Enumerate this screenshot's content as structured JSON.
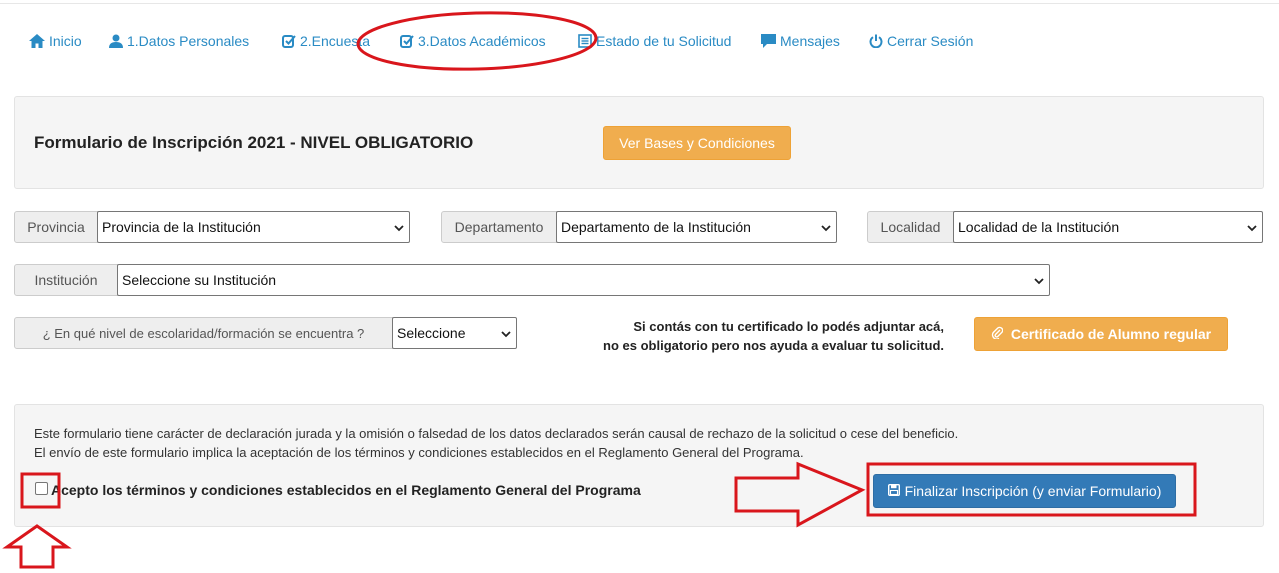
{
  "nav": {
    "inicio": "Inicio",
    "datos_personales": "1.Datos Personales",
    "encuesta": "2.Encuesta",
    "datos_academicos": "3.Datos Académicos",
    "estado_solicitud": "Estado de tu Solicitud",
    "mensajes": "Mensajes",
    "cerrar_sesion": "Cerrar Sesión"
  },
  "header": {
    "title": "Formulario de Inscripción 2021 - NIVEL OBLIGATORIO",
    "bases_button": "Ver Bases y Condiciones"
  },
  "filters": {
    "provincia": {
      "label": "Provincia",
      "value": "Provincia de la Institución"
    },
    "departamento": {
      "label": "Departamento",
      "value": "Departamento de la Institución"
    },
    "localidad": {
      "label": "Localidad",
      "value": "Localidad de la Institución"
    },
    "institucion": {
      "label": "Institución",
      "value": "Seleccione su Institución"
    },
    "nivel": {
      "label": "¿ En qué nivel de escolaridad/formación se encuentra ?",
      "value": "Seleccione"
    }
  },
  "certificate": {
    "note_line1": "Si contás con tu certificado lo podés adjuntar acá,",
    "note_line2": "no es obligatorio pero nos ayuda a evaluar tu solicitud.",
    "button": "Certificado de Alumno regular"
  },
  "declaration": {
    "line1": "Este formulario tiene carácter de declaración jurada y la omisión o falsedad de los datos declarados serán causal de rechazo de la solicitud o cese del beneficio.",
    "line2": "El envío de este formulario implica la aceptación de los términos y condiciones establecidos en el Reglamento General del Programa.",
    "accept_label": "Acepto los términos y condiciones establecidos en el Reglamento General del Programa",
    "accept_checked": false,
    "submit_button": "Finalizar Inscripción (y enviar Formulario)"
  },
  "colors": {
    "link": "#2a8bc4",
    "orange": "#f0ad4e",
    "blue": "#337ab7",
    "annotation_red": "#d9161c"
  },
  "icons": [
    "home-icon",
    "user-icon",
    "edit-icon",
    "list-icon",
    "comment-icon",
    "power-icon",
    "paperclip-icon",
    "floppy-icon",
    "chevron-down-icon"
  ]
}
